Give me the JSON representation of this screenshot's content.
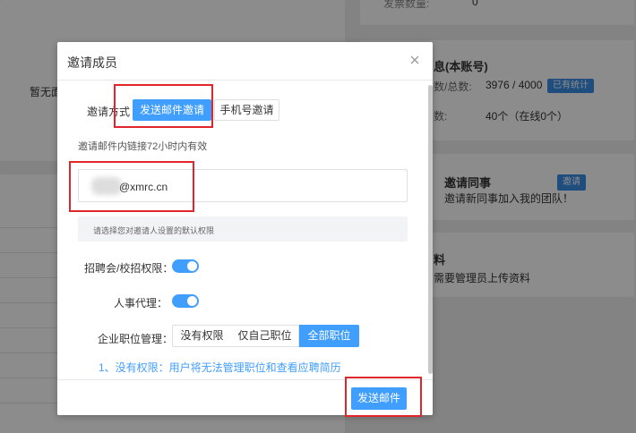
{
  "background": {
    "top_field_label": "发票数量:",
    "top_field_value": "0",
    "empty_text": "暂无面",
    "account_title": "息(本账号)",
    "account_row1_label": "数/总数:",
    "account_row1_value": "3976 / 4000",
    "account_row1_badge": "已有统计",
    "account_row2_label": "数:",
    "account_row2_value": "40个（在线0个）",
    "invite_title": "邀请同事",
    "invite_desc": "邀请新同事加入我的团队！",
    "invite_button": "邀请",
    "material_title": "料",
    "material_desc": "需要管理员上传资料"
  },
  "modal": {
    "title": "邀请成员",
    "invite_method_label": "邀请方式",
    "tab_email": "发送邮件邀请",
    "tab_phone": "手机号邀请",
    "validity_text": "邀请邮件内链接72小时内有效",
    "email_value": "@xmrc.cn",
    "hint_text": "请选择您对邀请人设置的默认权限",
    "permission_recruit_label": "招聘会/校招权限：",
    "permission_recruit_on": true,
    "permission_hr_label": "人事代理：",
    "permission_hr_on": true,
    "position_mgmt_label": "企业职位管理：",
    "position_options": [
      "没有权限",
      "仅自己职位",
      "全部职位"
    ],
    "position_selected": "全部职位",
    "note_text": "1、没有权限：用户将无法管理职位和查看应聘简历",
    "send_button": "发送邮件"
  },
  "colors": {
    "primary": "#409eff",
    "annotation_red": "#e0262b"
  }
}
